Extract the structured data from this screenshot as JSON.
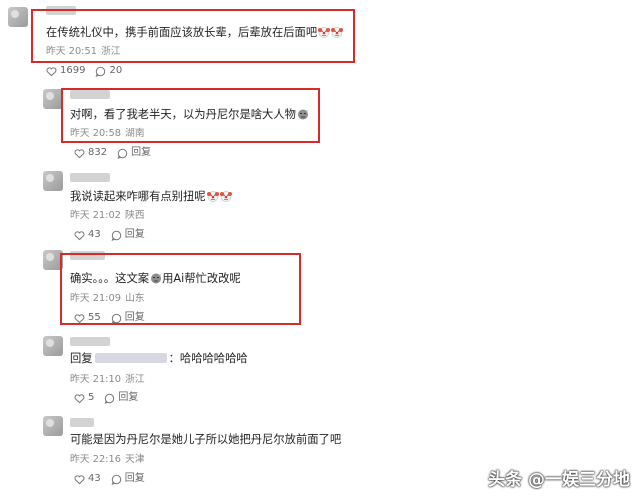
{
  "comments": [
    {
      "text": "在传统礼仪中，携手前面应该放长辈，后辈放在后面吧",
      "time": "昨天 20:51",
      "location": "浙江",
      "likes": "1699",
      "replies": "20"
    },
    {
      "text": "对啊，看了我老半天，以为丹尼尔是啥大人物",
      "time": "昨天 20:58",
      "location": "湖南",
      "likes": "832",
      "reply_label": "回复"
    },
    {
      "text": "我说读起来咋哪有点别扭呢",
      "time": "昨天 21:02",
      "location": "陕西",
      "likes": "43",
      "reply_label": "回复"
    },
    {
      "text_a": "确实。。。这文案",
      "text_b": "用Ai帮忙改改呢",
      "time": "昨天 21:09",
      "location": "山东",
      "likes": "55",
      "reply_label": "回复"
    },
    {
      "text_prefix": "回复",
      "text": "：哈哈哈哈哈哈",
      "time": "昨天 21:10",
      "location": "浙江",
      "likes": "5",
      "reply_label": "回复"
    },
    {
      "text": "可能是因为丹尼尔是她儿子所以她把丹尼尔放前面了吧",
      "time": "昨天 22:16",
      "location": "天津",
      "likes": "43",
      "reply_label": "回复"
    }
  ],
  "watermark": "头条 @一娱三分地",
  "colors": {
    "highlight_border": "#d62b2b",
    "meta_text": "#8a8a8a"
  }
}
